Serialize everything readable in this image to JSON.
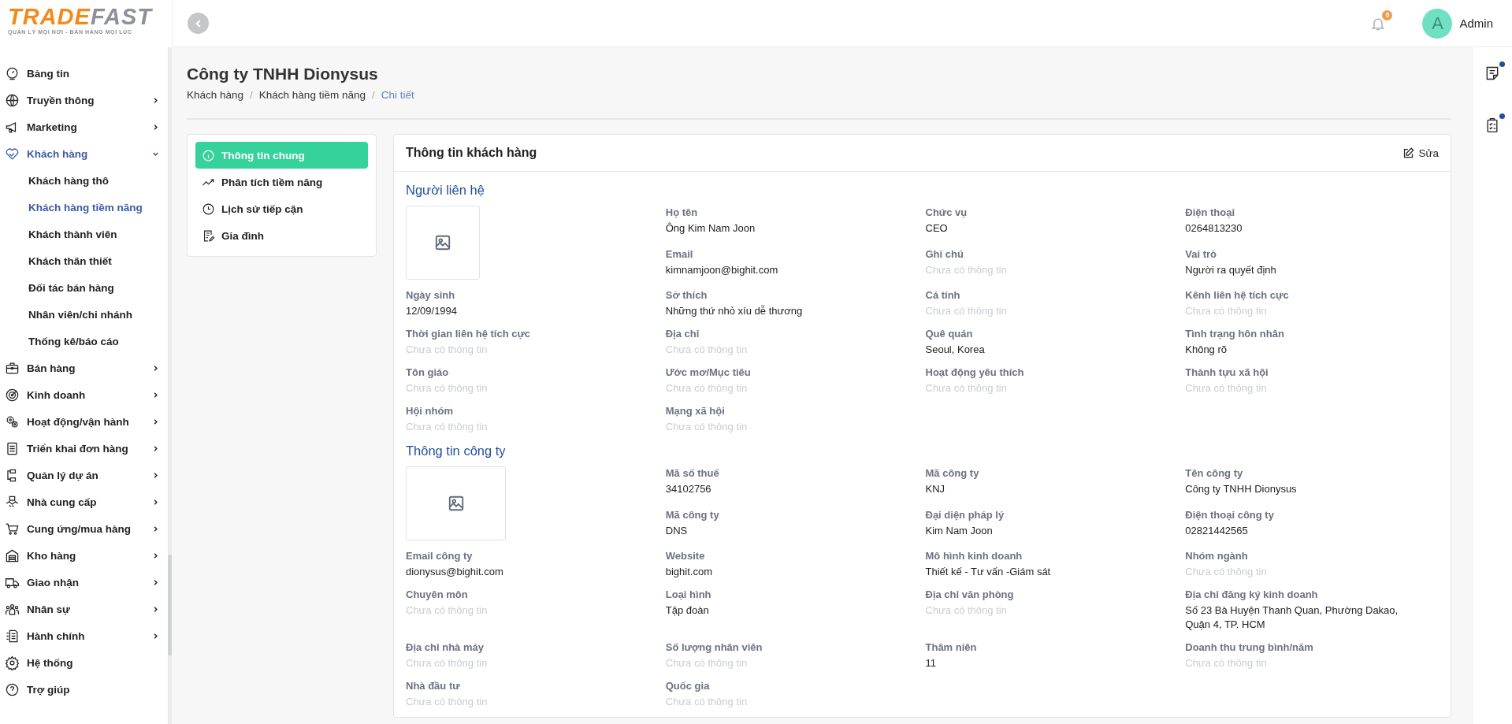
{
  "logo": {
    "word_start": "TRADE",
    "word_end": "FAST",
    "tagline": "QUẢN LÝ MỌI NƠI - BÁN HÀNG MỌI LÚC"
  },
  "sidebar": {
    "items": [
      {
        "label": "Bảng tin",
        "kind": "link",
        "selected": false
      },
      {
        "label": "Truyền thông",
        "kind": "group",
        "expanded": false,
        "selected": false
      },
      {
        "label": "Marketing",
        "kind": "group",
        "expanded": false,
        "selected": false
      },
      {
        "label": "Khách hàng",
        "kind": "group",
        "expanded": true,
        "selected": true,
        "children": [
          {
            "label": "Khách hàng thô",
            "selected": false
          },
          {
            "label": "Khách hàng tiềm năng",
            "selected": true
          },
          {
            "label": "Khách thành viên",
            "selected": false
          },
          {
            "label": "Khách thân thiết",
            "selected": false
          },
          {
            "label": "Đối tác bán hàng",
            "selected": false
          },
          {
            "label": "Nhân viên/chi nhánh",
            "selected": false
          },
          {
            "label": "Thống kê/báo cáo",
            "selected": false
          }
        ]
      },
      {
        "label": "Bán hàng",
        "kind": "group",
        "expanded": false,
        "selected": false
      },
      {
        "label": "Kinh doanh",
        "kind": "group",
        "expanded": false,
        "selected": false
      },
      {
        "label": "Hoạt động/vận hành",
        "kind": "group",
        "expanded": false,
        "selected": false
      },
      {
        "label": "Triển khai đơn hàng",
        "kind": "group",
        "expanded": false,
        "selected": false
      },
      {
        "label": "Quản lý dự án",
        "kind": "group",
        "expanded": false,
        "selected": false
      },
      {
        "label": "Nhà cung cấp",
        "kind": "group",
        "expanded": false,
        "selected": false
      },
      {
        "label": "Cung ứng/mua hàng",
        "kind": "group",
        "expanded": false,
        "selected": false
      },
      {
        "label": "Kho hàng",
        "kind": "group",
        "expanded": false,
        "selected": false
      },
      {
        "label": "Giao nhận",
        "kind": "group",
        "expanded": false,
        "selected": false
      },
      {
        "label": "Nhân sự",
        "kind": "group",
        "expanded": false,
        "selected": false
      },
      {
        "label": "Hành chính",
        "kind": "group",
        "expanded": false,
        "selected": false
      },
      {
        "label": "Hệ thống",
        "kind": "link",
        "selected": false
      },
      {
        "label": "Trợ giúp",
        "kind": "link",
        "selected": false
      }
    ]
  },
  "header": {
    "notification_count": "0",
    "user": {
      "initial": "A",
      "name": "Admin"
    }
  },
  "right_rail": [
    {
      "unread": true
    },
    {
      "unread": true
    }
  ],
  "page": {
    "title": "Công ty TNHH Dionysus",
    "separator": "/",
    "breadcrumb": [
      {
        "label": "Khách hàng",
        "current": false
      },
      {
        "label": "Khách hàng tiềm năng",
        "current": false
      },
      {
        "label": "Chi tiết",
        "current": true
      }
    ]
  },
  "tabs": [
    {
      "label": "Thông tin chung",
      "selected": true
    },
    {
      "label": "Phân tích tiềm năng",
      "selected": false
    },
    {
      "label": "Lịch sử tiếp cận",
      "selected": false
    },
    {
      "label": "Gia đình",
      "selected": false
    }
  ],
  "card": {
    "title": "Thông tin khách hàng",
    "edit": "Sửa",
    "sections": [
      {
        "kind": "contact",
        "title": "Người liên hệ",
        "fields": [
          {
            "label": "Họ tên",
            "value": "Ông Kim Nam Joon",
            "empty": false
          },
          {
            "label": "Chức vụ",
            "value": "CEO",
            "empty": false
          },
          {
            "label": "Điện thoại",
            "value": "0264813230",
            "empty": false
          },
          {
            "label": "Email",
            "value": "kimnamjoon@bighit.com",
            "empty": false
          },
          {
            "label": "Ghi chú",
            "value": "Chưa có thông tin",
            "empty": true
          },
          {
            "label": "Vai trò",
            "value": "Người ra quyết định",
            "empty": false
          },
          {
            "label": "Ngày sinh",
            "value": "12/09/1994",
            "empty": false
          },
          {
            "label": "Sở thích",
            "value": "Những thứ nhỏ xíu dễ thương",
            "empty": false
          },
          {
            "label": "Cá tính",
            "value": "Chưa có thông tin",
            "empty": true
          },
          {
            "label": "Kênh liên hệ tích cực",
            "value": "Chưa có thông tin",
            "empty": true
          },
          {
            "label": "Thời gian liên hệ tích cực",
            "value": "Chưa có thông tin",
            "empty": true
          },
          {
            "label": "Địa chỉ",
            "value": "Chưa có thông tin",
            "empty": true
          },
          {
            "label": "Quê quán",
            "value": "Seoul, Korea",
            "empty": false
          },
          {
            "label": "Tình trạng hôn nhân",
            "value": "Không rõ",
            "empty": false
          },
          {
            "label": "Tôn giáo",
            "value": "Chưa có thông tin",
            "empty": true
          },
          {
            "label": "Ước mơ/Mục tiêu",
            "value": "Chưa có thông tin",
            "empty": true
          },
          {
            "label": "Hoạt động yêu thích",
            "value": "Chưa có thông tin",
            "empty": true
          },
          {
            "label": "Thành tựu xã hội",
            "value": "Chưa có thông tin",
            "empty": true
          },
          {
            "label": "Hội nhóm",
            "value": "Chưa có thông tin",
            "empty": true
          },
          {
            "label": "Mạng xã hội",
            "value": "Chưa có thông tin",
            "empty": true
          }
        ]
      },
      {
        "kind": "company",
        "title": "Thông tin công ty",
        "fields": [
          {
            "label": "Mã số thuế",
            "value": "34102756",
            "empty": false
          },
          {
            "label": "Mã công ty",
            "value": "KNJ",
            "empty": false
          },
          {
            "label": "Tên công ty",
            "value": "Công ty TNHH Dionysus",
            "empty": false
          },
          {
            "label": "Mã công ty",
            "value": "DNS",
            "empty": false
          },
          {
            "label": "Đại diện pháp lý",
            "value": "Kim Nam Joon",
            "empty": false
          },
          {
            "label": "Điện thoại công ty",
            "value": "02821442565",
            "empty": false
          },
          {
            "label": "Email công ty",
            "value": "dionysus@bighit.com",
            "empty": false
          },
          {
            "label": "Website",
            "value": "bighit.com",
            "empty": false
          },
          {
            "label": "Mô hình kinh doanh",
            "value": "Thiết kế - Tư vấn -Giám sát",
            "empty": false
          },
          {
            "label": "Nhóm ngành",
            "value": "Chưa có thông tin",
            "empty": true
          },
          {
            "label": "Chuyên môn",
            "value": "Chưa có thông tin",
            "empty": true
          },
          {
            "label": "Loại hình",
            "value": "Tập đoàn",
            "empty": false
          },
          {
            "label": "Địa chỉ văn phòng",
            "value": "Chưa có thông tin",
            "empty": true
          },
          {
            "label": "Địa chỉ đăng ký kinh doanh",
            "value": "Số 23 Bà Huyện Thanh Quan, Phường Dakao, Quận 4, TP. HCM",
            "empty": false
          },
          {
            "label": "Địa chỉ nhà máy",
            "value": "Chưa có thông tin",
            "empty": true
          },
          {
            "label": "Số lượng nhân viên",
            "value": "Chưa có thông tin",
            "empty": true
          },
          {
            "label": "Thâm niên",
            "value": "11",
            "empty": false
          },
          {
            "label": "Doanh thu trung bình/năm",
            "value": "Chưa có thông tin",
            "empty": true
          },
          {
            "label": "Nhà đầu tư",
            "value": "Chưa có thông tin",
            "empty": true
          },
          {
            "label": "Quốc gia",
            "value": "Chưa có thông tin",
            "empty": true
          }
        ]
      }
    ]
  }
}
